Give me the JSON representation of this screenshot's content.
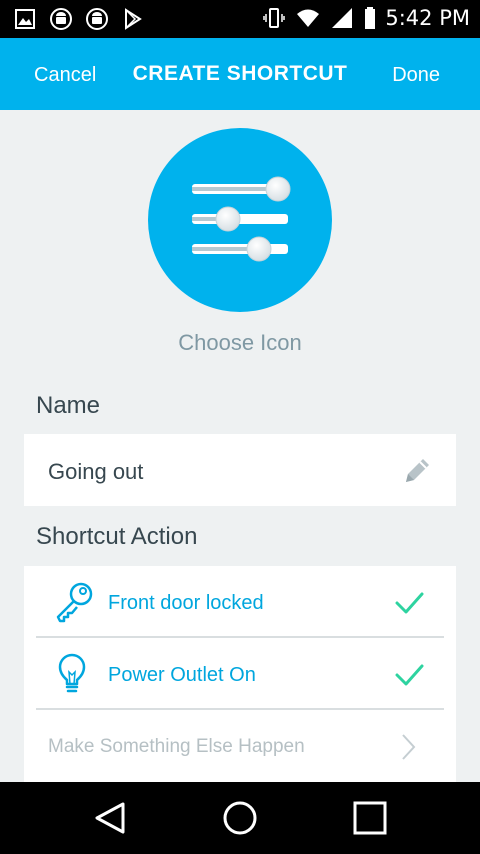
{
  "status_bar": {
    "time": "5:42 PM",
    "left_icons": [
      "image-icon",
      "android-icon",
      "android-icon",
      "play-store-icon"
    ],
    "right_icons": [
      "vibrate-icon",
      "wifi-icon",
      "signal-icon",
      "battery-icon"
    ]
  },
  "header": {
    "cancel_label": "Cancel",
    "title": "CREATE SHORTCUT",
    "done_label": "Done"
  },
  "icon_picker": {
    "icon": "sliders-icon",
    "label": "Choose Icon"
  },
  "name_section": {
    "title": "Name",
    "value": "Going out",
    "edit_icon": "pencil-icon"
  },
  "action_section": {
    "title": "Shortcut Action",
    "items": [
      {
        "label": "Front door locked",
        "icon": "key-icon",
        "status_icon": "checkmark-icon"
      },
      {
        "label": "Power Outlet On",
        "icon": "lightbulb-icon",
        "status_icon": "checkmark-icon"
      }
    ],
    "add_label": "Make Something Else Happen",
    "add_icon": "chevron-right-icon"
  },
  "colors": {
    "accent": "#00b2ed",
    "check": "#2ed3a0",
    "background": "#eef1f2",
    "text_dark": "#37474f",
    "muted": "#7f98a3"
  },
  "nav_bar": {
    "buttons": [
      "back-icon",
      "home-icon",
      "recent-apps-icon"
    ]
  }
}
